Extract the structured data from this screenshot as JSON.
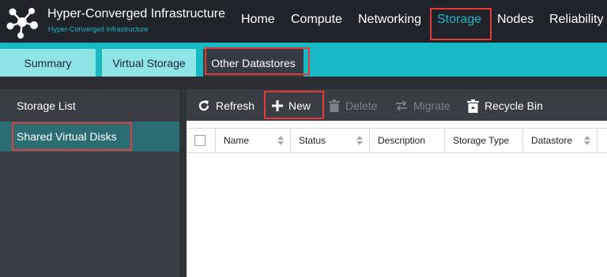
{
  "app": {
    "title": "Hyper-Converged Infrastructure",
    "subtitle": "Hyper-Converged Infrastructure",
    "logo_icon": "network-nodes-icon"
  },
  "nav": {
    "items": [
      {
        "label": "Home",
        "active": false
      },
      {
        "label": "Compute",
        "active": false
      },
      {
        "label": "Networking",
        "active": false
      },
      {
        "label": "Storage",
        "active": true
      },
      {
        "label": "Nodes",
        "active": false
      },
      {
        "label": "Reliability",
        "active": false
      }
    ]
  },
  "tabs": [
    {
      "label": "Summary",
      "active": false
    },
    {
      "label": "Virtual Storage",
      "active": false
    },
    {
      "label": "Other Datastores",
      "active": true
    }
  ],
  "sidebar": {
    "items": [
      {
        "label": "Storage List",
        "active": false
      },
      {
        "label": "Shared Virtual Disks",
        "active": true
      }
    ]
  },
  "toolbar": {
    "refresh": {
      "label": "Refresh",
      "icon": "refresh-icon",
      "enabled": true
    },
    "new": {
      "label": "New",
      "icon": "plus-icon",
      "enabled": true
    },
    "delete": {
      "label": "Delete",
      "icon": "trash-icon",
      "enabled": false
    },
    "migrate": {
      "label": "Migrate",
      "icon": "migrate-arrows-icon",
      "enabled": false
    },
    "recycle_bin": {
      "label": "Recycle Bin",
      "icon": "recycle-bin-icon",
      "enabled": true
    }
  },
  "table": {
    "columns": [
      {
        "label": "Name",
        "sortable": true
      },
      {
        "label": "Status",
        "sortable": true
      },
      {
        "label": "Description",
        "sortable": false
      },
      {
        "label": "Storage Type",
        "sortable": false
      },
      {
        "label": "Datastore",
        "sortable": true
      }
    ],
    "rows": []
  },
  "colors": {
    "accent": "#1fb6c6",
    "topbar": "#20232a",
    "tabstrip": "#17b9c5",
    "highlight": "#e33b3b"
  }
}
